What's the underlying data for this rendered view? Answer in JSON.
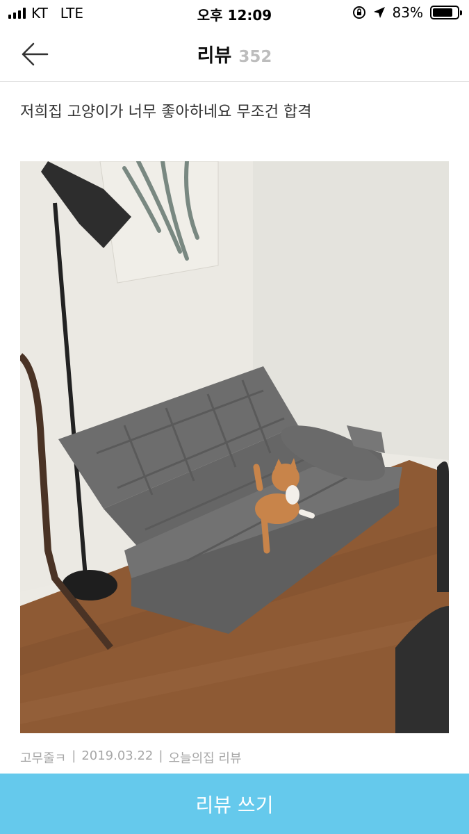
{
  "status_bar": {
    "carrier": "KT",
    "network": "LTE",
    "time": "오후 12:09",
    "battery": "83%",
    "battery_level": 0.83
  },
  "header": {
    "title": "리뷰",
    "count": "352",
    "back_icon": "arrow-left-icon"
  },
  "review": {
    "text": "저희집 고양이가 너무 좋아하네요 무조건 합격",
    "photo_description_icon": "review-photo"
  },
  "meta": {
    "author": "고무줄ㅋ",
    "separator": "|",
    "date": "2019.03.22",
    "source": "오늘의집 리뷰"
  },
  "footer": {
    "write_label": "리뷰 쓰기"
  },
  "colors": {
    "accent": "#65c9ec",
    "muted": "#a7a7a7",
    "count": "#bdbdbd"
  }
}
